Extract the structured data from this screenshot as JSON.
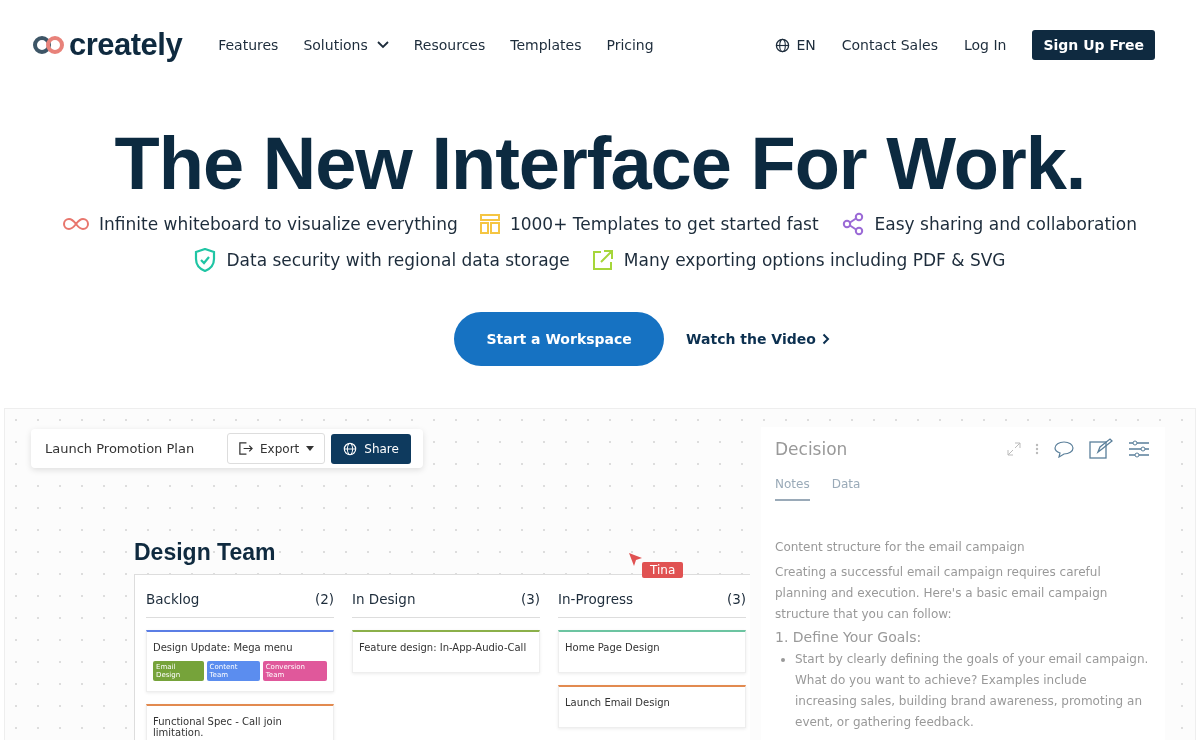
{
  "nav": {
    "logo": "creately",
    "links": [
      {
        "label": "Features",
        "dropdown": false
      },
      {
        "label": "Solutions",
        "dropdown": true
      },
      {
        "label": "Resources",
        "dropdown": false
      },
      {
        "label": "Templates",
        "dropdown": false
      },
      {
        "label": "Pricing",
        "dropdown": false
      }
    ],
    "language": "EN",
    "contact": "Contact Sales",
    "login": "Log In",
    "signup": "Sign Up Free"
  },
  "hero": {
    "title": "The New Interface For Work.",
    "features": [
      {
        "kind": "infinity",
        "text": "Infinite whiteboard to visualize everything",
        "color": "#e8766d"
      },
      {
        "kind": "templates",
        "text": "1000+ Templates to get started fast",
        "color": "#f5c542"
      },
      {
        "kind": "share",
        "text": "Easy sharing and collaboration",
        "color": "#9b6ad6"
      },
      {
        "kind": "shield",
        "text": "Data security with regional data storage",
        "color": "#1fc5a4"
      },
      {
        "kind": "export",
        "text": "Many exporting options including PDF & SVG",
        "color": "#a6d63a"
      }
    ],
    "primary_button": "Start a Workspace",
    "video_link": "Watch the Video"
  },
  "preview": {
    "toolbar": {
      "document_title": "Launch Promotion Plan",
      "export": "Export",
      "share": "Share"
    },
    "board_title": "Design Team",
    "cursor_label": "Tina",
    "columns": [
      {
        "name": "Backlog",
        "count": "(2)",
        "cards": [
          {
            "title": "Design Update: Mega menu",
            "color": "#5b7ee5",
            "tags": [
              {
                "label": "Email Design",
                "color": "#76a33a"
              },
              {
                "label": "Content Team",
                "color": "#5b8def"
              },
              {
                "label": "Conversion Team",
                "color": "#e0589b"
              }
            ]
          },
          {
            "title": "Functional Spec - Call join limitation.",
            "color": "#e28a4f"
          }
        ]
      },
      {
        "name": "In Design",
        "count": "(3)",
        "cards": [
          {
            "title": "Feature design: In-App-Audio-Call",
            "color": "#8bb04a"
          }
        ]
      },
      {
        "name": "In-Progress",
        "count": "(3)",
        "cards": [
          {
            "title": "Home Page Design",
            "color": "#6cc4a1"
          },
          {
            "title": "Launch Email Design",
            "color": "#e28a4f"
          }
        ]
      }
    ],
    "panel": {
      "title": "Decision",
      "tabs": [
        {
          "label": "Notes",
          "selected": true
        },
        {
          "label": "Data",
          "selected": false
        }
      ],
      "paragraphs": [
        "Content structure for the email campaign",
        "Creating a successful email campaign requires careful planning and execution. Here's a basic email campaign structure that you can follow:"
      ],
      "heading": "1. Define Your Goals:",
      "bullet": "Start by clearly defining the goals of your email campaign. What do you want to achieve? Examples include increasing sales, building brand awareness, promoting an event, or gathering feedback."
    }
  }
}
